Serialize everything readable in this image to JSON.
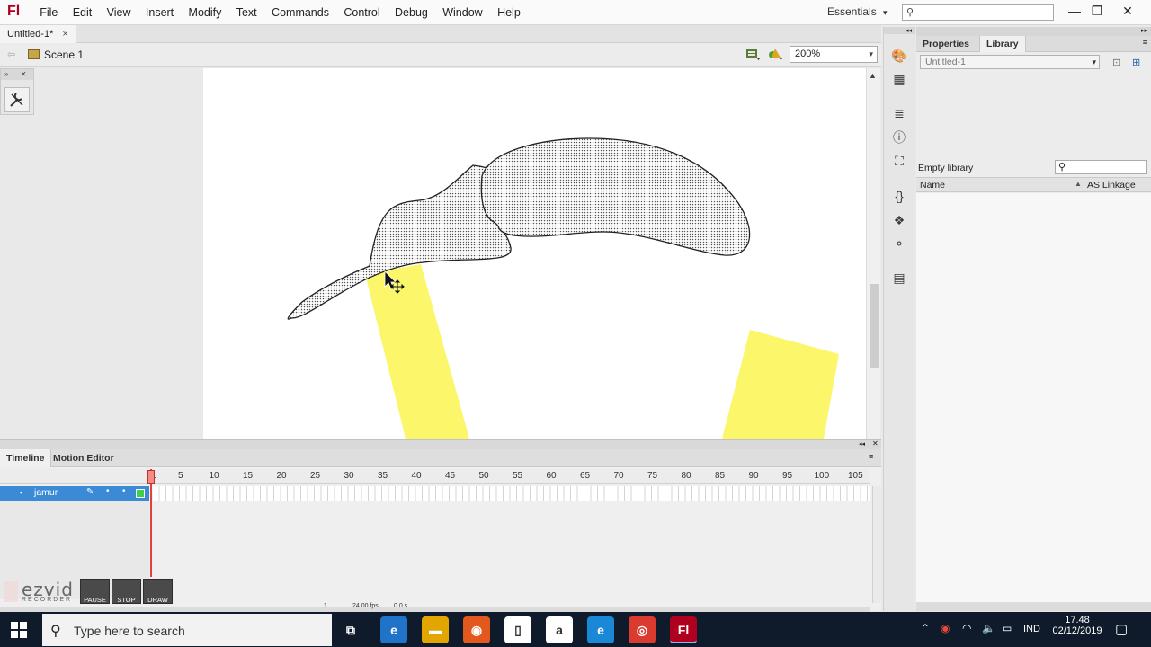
{
  "app": {
    "logo": "Fl"
  },
  "menu": [
    "File",
    "Edit",
    "View",
    "Insert",
    "Modify",
    "Text",
    "Commands",
    "Control",
    "Debug",
    "Window",
    "Help"
  ],
  "workspace": {
    "label": "Essentials",
    "arrow": "▾"
  },
  "window_controls": {
    "minimize": "—",
    "restore": "❐",
    "close": "✕"
  },
  "document_tab": {
    "title": "Untitled-1*",
    "close": "×"
  },
  "scene": {
    "label": "Scene 1",
    "zoom": "200%"
  },
  "library": {
    "tabs": [
      "Properties",
      "Library"
    ],
    "active_tab": "Library",
    "document": "Untitled-1",
    "empty_text": "Empty library",
    "columns": {
      "name": "Name",
      "linkage": "AS Linkage"
    }
  },
  "timeline": {
    "tabs": [
      "Timeline",
      "Motion Editor"
    ],
    "active_tab": "Timeline",
    "layer": "jamur",
    "ruler": [
      "1",
      "5",
      "10",
      "15",
      "20",
      "25",
      "30",
      "35",
      "40",
      "45",
      "50",
      "55",
      "60",
      "65",
      "70",
      "75",
      "80",
      "85",
      "90",
      "95",
      "100",
      "105"
    ],
    "fps": "24.00 fps",
    "time": "0.0 s",
    "frame": "1"
  },
  "recorder": {
    "logo": "ezvid",
    "sub": "RECORDER",
    "buttons": [
      "PAUSE",
      "STOP",
      "DRAW"
    ]
  },
  "taskbar": {
    "search_placeholder": "Type here to search",
    "language": "IND",
    "time": "17.48",
    "date": "02/12/2019",
    "apps": [
      {
        "name": "task-view",
        "color": "#0f1b2a"
      },
      {
        "name": "edge-legacy",
        "color": "#1f73c8"
      },
      {
        "name": "file-explorer",
        "color": "#e3a500"
      },
      {
        "name": "firefox",
        "color": "#e2581d"
      },
      {
        "name": "notepad",
        "color": "#ffffff"
      },
      {
        "name": "amazon",
        "color": "#ffffff"
      },
      {
        "name": "edge",
        "color": "#1a88d6"
      },
      {
        "name": "chrome",
        "color": "#db3b2f"
      },
      {
        "name": "flash",
        "color": "#b00020"
      }
    ]
  },
  "colors": {
    "layer_highlight": "#3a8ad6",
    "shape_fill": "#fbf66a",
    "playhead": "#e0413a"
  }
}
